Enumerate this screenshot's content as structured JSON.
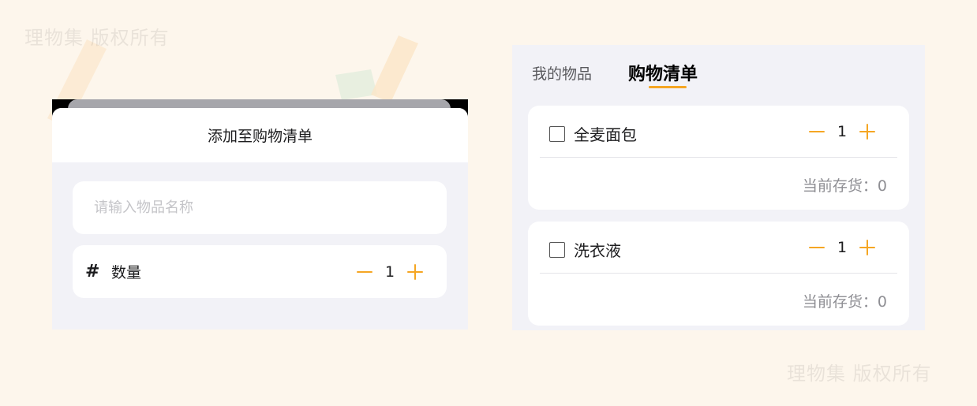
{
  "watermark": {
    "text": "理物集 版权所有"
  },
  "add_sheet": {
    "title": "添加至购物清单",
    "name_input": {
      "placeholder": "请输入物品名称",
      "value": ""
    },
    "quantity": {
      "icon": "hash-icon",
      "label": "数量",
      "value": "1",
      "minus": "−",
      "plus": "+"
    }
  },
  "shopping_list": {
    "tabs": [
      {
        "label": "我的物品",
        "active": false
      },
      {
        "label": "购物清单",
        "active": true
      }
    ],
    "items": [
      {
        "name": "全麦面包",
        "checked": false,
        "quantity": "1",
        "stock_label": "当前存货：",
        "stock_value": "0"
      },
      {
        "name": "洗衣液",
        "checked": false,
        "quantity": "1",
        "stock_label": "当前存货：",
        "stock_value": "0"
      }
    ]
  },
  "colors": {
    "accent": "#f5a623",
    "page_background": "#fdf6ec",
    "panel_background": "#f2f2f7",
    "card_background": "#ffffff"
  }
}
